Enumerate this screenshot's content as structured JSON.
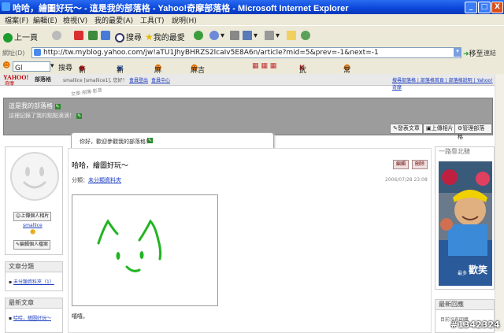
{
  "window": {
    "title": "哈哈，繪圖好玩～ - 這是我的部落格 - Yahoo!奇摩部落格 - Microsoft Internet Explorer",
    "min": "_",
    "max": "□",
    "close": "X"
  },
  "menu": [
    "檔案(F)",
    "編輯(E)",
    "檢視(V)",
    "我的最愛(A)",
    "工具(T)",
    "說明(H)"
  ],
  "toolbar": {
    "back": "上一頁",
    "search": "搜尋",
    "favorites": "我的最愛"
  },
  "address": {
    "label": "網址(D)",
    "url": "http://tw.myblog.yahoo.com/jw!aTU1JhyBHRZS2lcaIv5E8A6n/article?mid=5&prev=-1&next=-1",
    "go": "移至",
    "links": "連結"
  },
  "linksbar": {
    "search_value": "Gl",
    "search": "搜尋",
    "items": [
      "新浪網",
      "新聞(0)",
      "麻吉網",
      "麻吉新話題(23)",
      "武林英雄",
      "常用網站"
    ]
  },
  "yahoo": {
    "logo_top": "YAHOO!",
    "logo_bottom": "奇摩",
    "section": "部落格",
    "user_info": "smallice [smallice1], 您好！",
    "header_links": [
      "會員登出",
      "會員中心"
    ],
    "right_links": "搜尋部落格 | 部落格首頁 | 部落格說明 | Yahoo!奇摩"
  },
  "blog": {
    "title": "這是我的部落格",
    "subtitle": "這裡記錄了我的點點滴滴！",
    "actions": [
      "發表文章",
      "上傳相片",
      "管理部落格"
    ],
    "welcome": "你好，歡迎參觀我的部落格！",
    "nav": "文章·相簿·影音"
  },
  "profile": {
    "upload_photo": "上傳個人相片",
    "username": "smallice",
    "edit_profile": "編輯個人檔案"
  },
  "categories": {
    "header": "文章分類",
    "items": [
      "未分類資料夾（1）"
    ]
  },
  "recent_articles": {
    "header": "最新文章",
    "items": [
      "哈哈，繪圖好玩～"
    ]
  },
  "article": {
    "title": "哈哈，繪圖好玩～",
    "edit": "編輯",
    "delete": "刪除",
    "category_label": "分類：",
    "category": "未分類資料夾",
    "date": "2006/07/28 23:08",
    "body": "嘻嘻，"
  },
  "right_panel": {
    "header": "一路靠北騎",
    "ad_text": "最多",
    "ad_big": "歡笑"
  },
  "recent_comments": {
    "header": "最新回應",
    "text": "目前沒有回應"
  },
  "watermark": "#1342324"
}
